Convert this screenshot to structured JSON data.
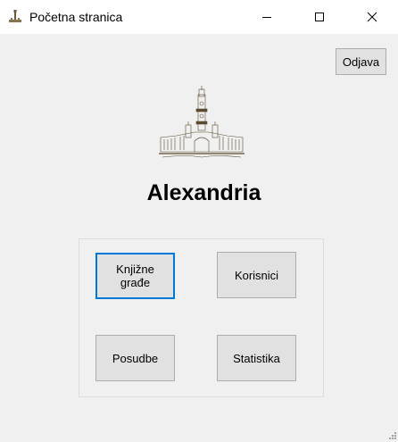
{
  "window": {
    "title": "Početna stranica",
    "icon": "cathedral-icon"
  },
  "header": {
    "logout_label": "Odjava",
    "app_title": "Alexandria"
  },
  "menu": {
    "items": [
      {
        "label": "Knjižne\ngrađe",
        "focused": true
      },
      {
        "label": "Korisnici",
        "focused": false
      },
      {
        "label": "Posudbe",
        "focused": false
      },
      {
        "label": "Statistika",
        "focused": false
      }
    ]
  },
  "colors": {
    "focus_border": "#0078d7",
    "button_face": "#e1e1e1",
    "window_background": "#f0f0f0"
  }
}
